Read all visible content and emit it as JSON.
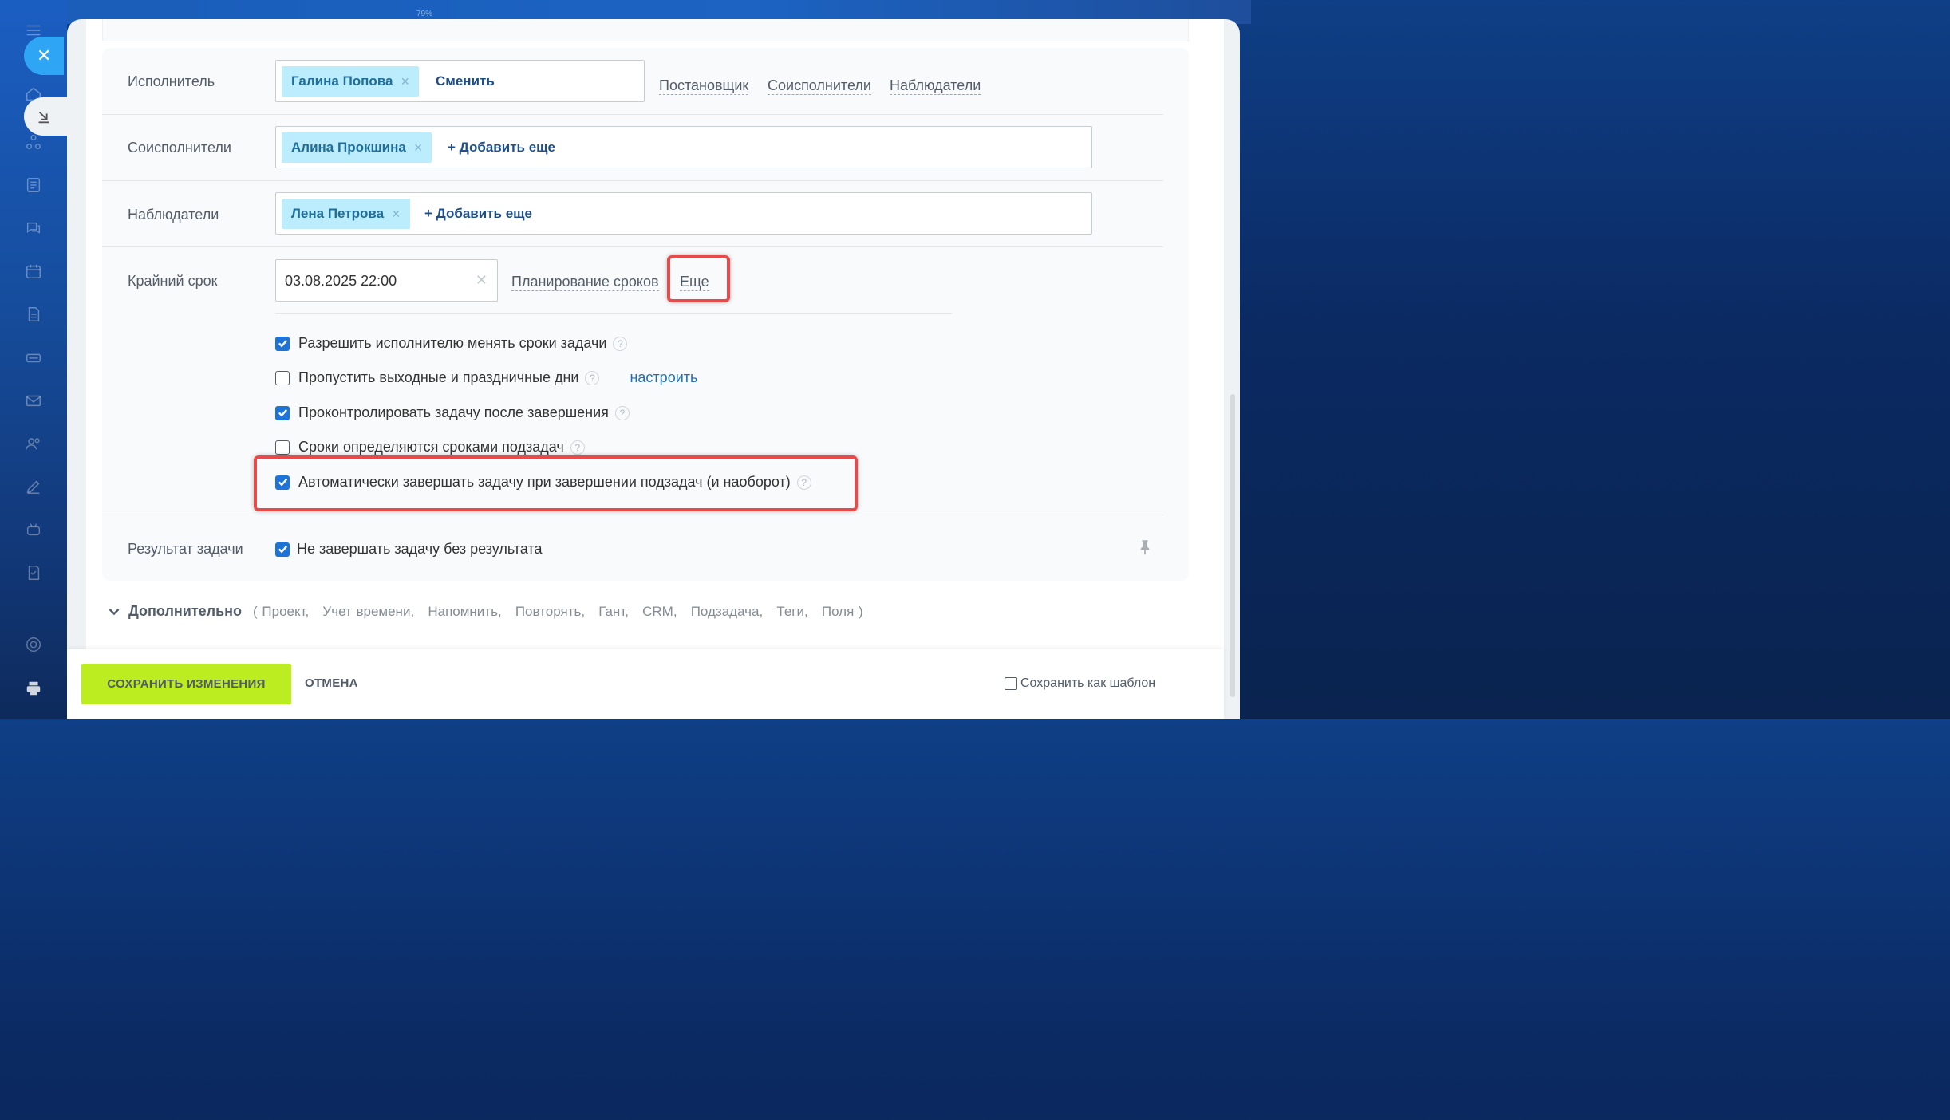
{
  "background": {
    "zoom_label": "79%"
  },
  "sidebar": {
    "icons": [
      "menu-icon",
      "home-icon",
      "crm-icon",
      "feed-icon",
      "chat-icon",
      "calendar-icon",
      "documents-icon",
      "drive-icon",
      "mail-icon",
      "contacts-icon",
      "edit-icon",
      "robot-icon",
      "tasks-icon",
      "settings-icon",
      "print-icon"
    ]
  },
  "form": {
    "assignee": {
      "label": "Исполнитель",
      "chip": "Галина Попова",
      "change_label": "Сменить",
      "extra_links": [
        "Постановщик",
        "Соисполнители",
        "Наблюдатели"
      ]
    },
    "coexecutors": {
      "label": "Соисполнители",
      "chip": "Алина Прокшина",
      "add_label": "+ Добавить еще"
    },
    "observers": {
      "label": "Наблюдатели",
      "chip": "Лена Петрова",
      "add_label": "+ Добавить еще"
    },
    "deadline": {
      "label": "Крайний срок",
      "value": "03.08.2025 22:00",
      "planning_label": "Планирование сроков",
      "more_label": "Еще"
    },
    "options": [
      {
        "label": "Разрешить исполнителю менять сроки задачи",
        "checked": true
      },
      {
        "label": "Пропустить выходные и праздничные дни",
        "checked": false,
        "link": "настроить"
      },
      {
        "label": "Проконтролировать задачу после завершения",
        "checked": true
      },
      {
        "label": "Сроки определяются сроками подзадач",
        "checked": false
      },
      {
        "label": "Автоматически завершать задачу при завершении подзадач (и наоборот)",
        "checked": true
      }
    ],
    "result": {
      "label": "Результат задачи",
      "option": "Не завершать задачу без результата",
      "checked": true
    },
    "additional": {
      "label": "Дополнительно",
      "items": "( Проект,   Учет времени,   Напомнить,   Повторять,   Гант,   CRM,   Подзадача,   Теги,   Поля )"
    }
  },
  "footer": {
    "save_label": "СОХРАНИТЬ ИЗМЕНЕНИЯ",
    "cancel_label": "ОТМЕНА",
    "template_label": "Сохранить как шаблон"
  },
  "colors": {
    "accent": "#bbed21",
    "chip": "#bcedfc",
    "highlight": "#e64a4a",
    "checkbox": "#1e73d8"
  }
}
